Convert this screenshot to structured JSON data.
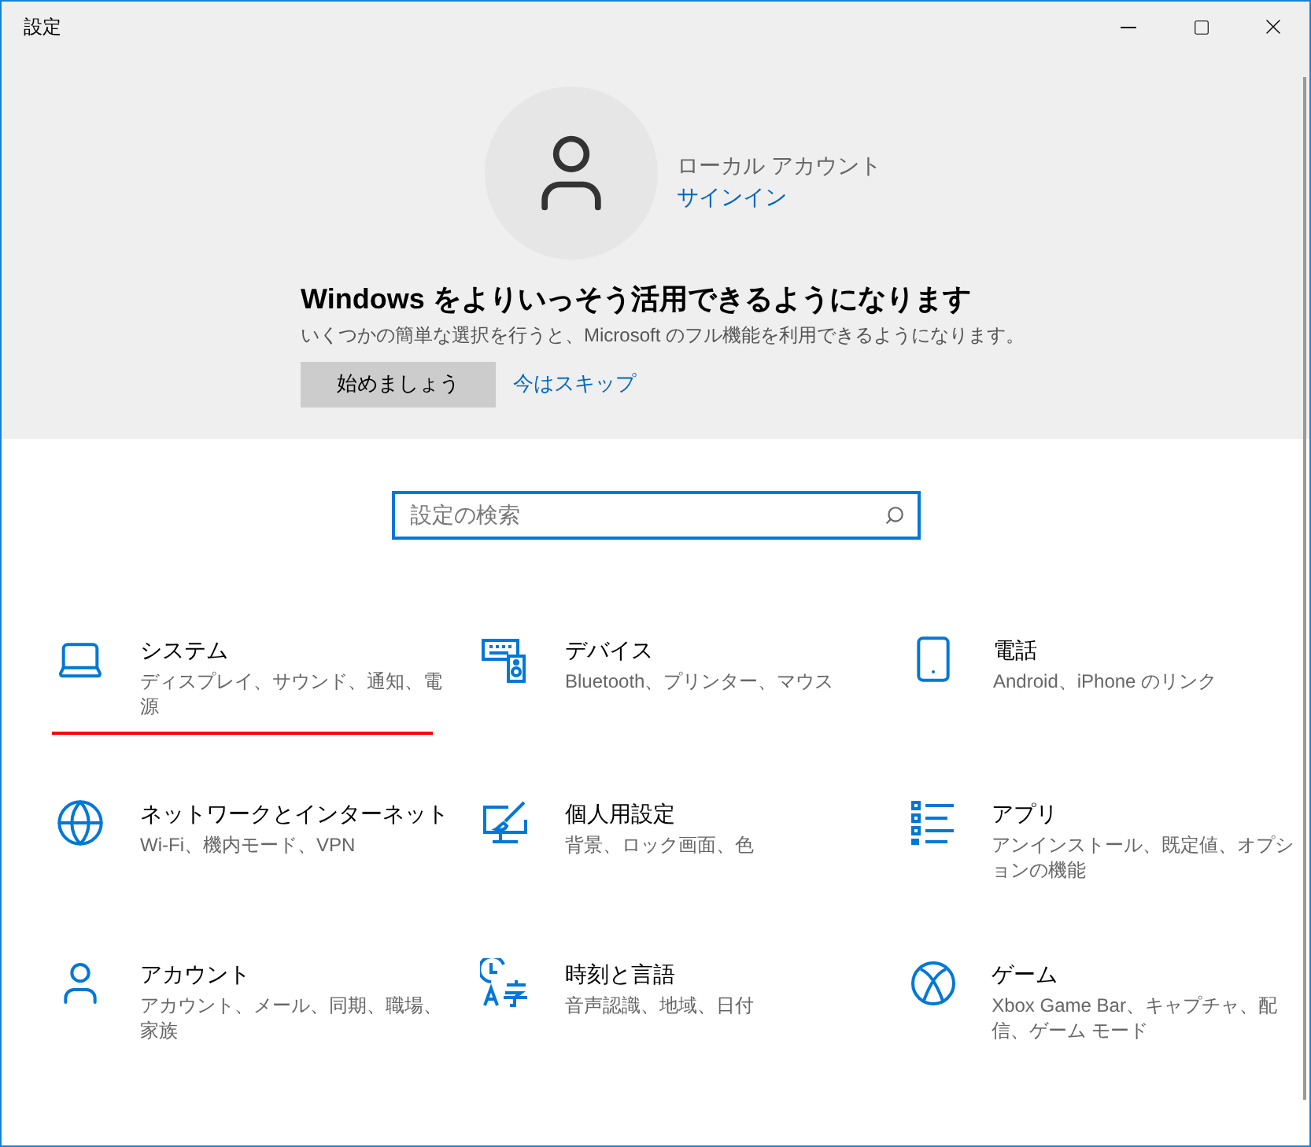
{
  "window": {
    "title": "設定"
  },
  "account": {
    "name": "ローカル アカウント",
    "link": "サインイン"
  },
  "promo": {
    "heading": "Windows をよりいっそう活用できるようになります",
    "text": "いくつかの簡単な選択を行うと、Microsoft のフル機能を利用できるようになります。",
    "primary": "始めましょう",
    "secondary": "今はスキップ"
  },
  "search": {
    "placeholder": "設定の検索"
  },
  "categories": [
    {
      "title": "システム",
      "description": "ディスプレイ、サウンド、通知、電源",
      "underlined": true
    },
    {
      "title": "デバイス",
      "description": "Bluetooth、プリンター、マウス",
      "underlined": false
    },
    {
      "title": "電話",
      "description": "Android、iPhone のリンク",
      "underlined": false
    },
    {
      "title": "ネットワークとインターネット",
      "description": "Wi-Fi、機内モード、VPN",
      "underlined": false
    },
    {
      "title": "個人用設定",
      "description": "背景、ロック画面、色",
      "underlined": false
    },
    {
      "title": "アプリ",
      "description": "アンインストール、既定値、オプションの機能",
      "underlined": false
    },
    {
      "title": "アカウント",
      "description": "アカウント、メール、同期、職場、家族",
      "underlined": false
    },
    {
      "title": "時刻と言語",
      "description": "音声認識、地域、日付",
      "underlined": false
    },
    {
      "title": "ゲーム",
      "description": "Xbox Game Bar、キャプチャ、配信、ゲーム モード",
      "underlined": false
    }
  ]
}
